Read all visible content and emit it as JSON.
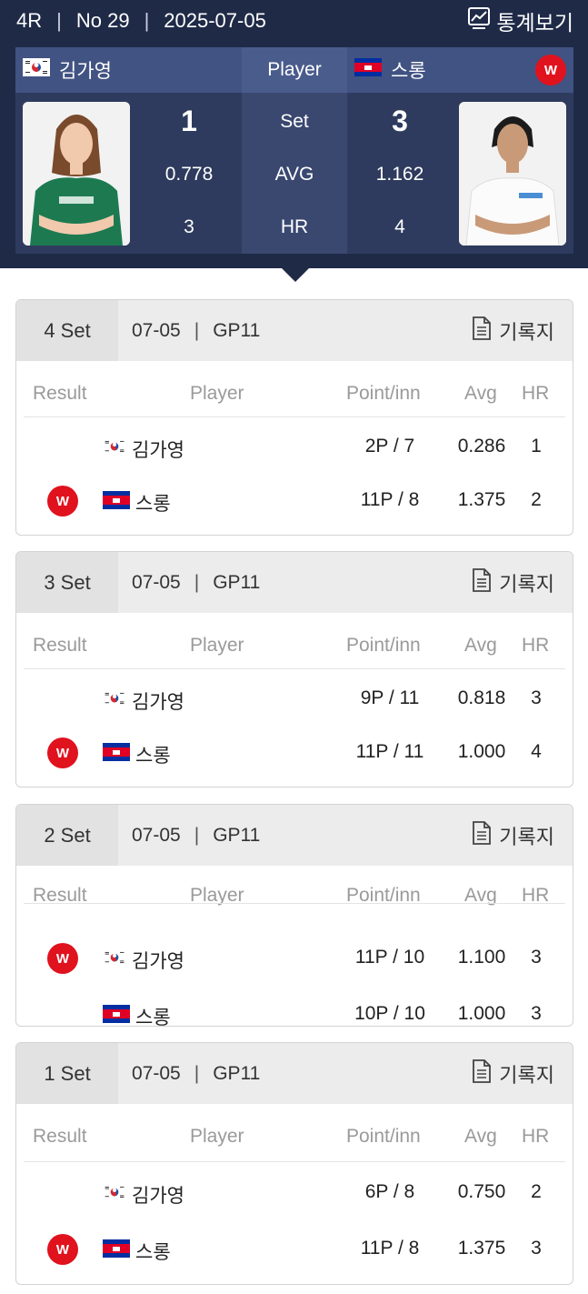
{
  "header": {
    "round": "4R",
    "match_no": "No 29",
    "date": "2025-07-05",
    "stats_label": "통계보기"
  },
  "scoreboard": {
    "player_label": "Player",
    "winner_badge": "W",
    "left": {
      "name": "김가영",
      "flag": "korea",
      "set": "1",
      "avg": "0.778",
      "hr": "3"
    },
    "right": {
      "name": "스롱",
      "flag": "cambodia",
      "set": "3",
      "avg": "1.162",
      "hr": "4"
    },
    "labels": {
      "set": "Set",
      "avg": "AVG",
      "hr": "HR"
    }
  },
  "columns": {
    "result": "Result",
    "player": "Player",
    "point": "Point/inn",
    "avg": "Avg",
    "hr": "HR"
  },
  "sets": [
    {
      "title": "4 Set",
      "date": "07-05",
      "venue": "GP11",
      "record_label": "기록지",
      "rows": [
        {
          "winner": false,
          "name": "김가영",
          "flag": "korea",
          "point": "2P / 7",
          "avg": "0.286",
          "hr": "1"
        },
        {
          "winner": true,
          "name": "스롱",
          "flag": "cambodia",
          "point": "11P / 8",
          "avg": "1.375",
          "hr": "2"
        }
      ]
    },
    {
      "title": "3 Set",
      "date": "07-05",
      "venue": "GP11",
      "record_label": "기록지",
      "rows": [
        {
          "winner": false,
          "name": "김가영",
          "flag": "korea",
          "point": "9P / 11",
          "avg": "0.818",
          "hr": "3"
        },
        {
          "winner": true,
          "name": "스롱",
          "flag": "cambodia",
          "point": "11P / 11",
          "avg": "1.000",
          "hr": "4"
        }
      ]
    },
    {
      "title": "2 Set",
      "date": "07-05",
      "venue": "GP11",
      "record_label": "기록지",
      "rows": [
        {
          "winner": true,
          "name": "김가영",
          "flag": "korea",
          "point": "11P / 10",
          "avg": "1.100",
          "hr": "3"
        },
        {
          "winner": false,
          "name": "스롱",
          "flag": "cambodia",
          "point": "10P / 10",
          "avg": "1.000",
          "hr": "3"
        }
      ]
    },
    {
      "title": "1 Set",
      "date": "07-05",
      "venue": "GP11",
      "record_label": "기록지",
      "rows": [
        {
          "winner": false,
          "name": "김가영",
          "flag": "korea",
          "point": "6P / 8",
          "avg": "0.750",
          "hr": "2"
        },
        {
          "winner": true,
          "name": "스롱",
          "flag": "cambodia",
          "point": "11P / 8",
          "avg": "1.375",
          "hr": "3"
        }
      ]
    }
  ]
}
